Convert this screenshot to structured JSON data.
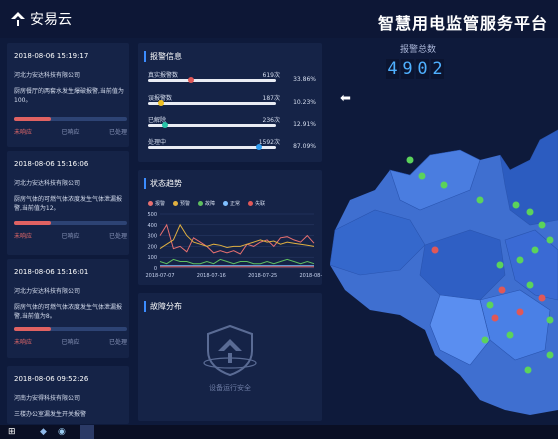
{
  "header": {
    "logo_text": "安易云",
    "title": "智慧用电监管服务平台"
  },
  "alarm_total": {
    "label": "报警总数",
    "digits": [
      "4",
      "9",
      "0",
      "2"
    ]
  },
  "feed": [
    {
      "time": "2018-08-06 15:19:17",
      "company": "河北力安达科技有限公司",
      "desc": "厨房餐厅的两套水发生爆破报警,当前值为100。",
      "progress": 0.33,
      "steps": [
        "未响应",
        "已响应",
        "已处理"
      ]
    },
    {
      "time": "2018-08-06 15:16:06",
      "company": "河北力安达科技有限公司",
      "desc": "厨房气体的可燃气体浓度发生气体泄漏报警,当前值为12。",
      "progress": 0.33,
      "steps": [
        "未响应",
        "已响应",
        "已处理"
      ]
    },
    {
      "time": "2018-08-06 15:16:01",
      "company": "河北力安达科技有限公司",
      "desc": "厨房气体的可燃气体浓度发生气体泄漏报警,当前值为8。",
      "progress": 0.33,
      "steps": [
        "未响应",
        "已响应",
        "已处理"
      ]
    },
    {
      "time": "2018-08-06 09:52:26",
      "company": "河南力安得科技有限公司",
      "desc": "三楼办公室漏发生开关报警"
    }
  ],
  "alarm_info": {
    "title": "报警信息",
    "rows": [
      {
        "label": "真实报警数",
        "count": "619次",
        "pct": "33.86%",
        "value": 0.3386,
        "color": "#e05858"
      },
      {
        "label": "误报警数",
        "count": "187次",
        "pct": "10.23%",
        "value": 0.1023,
        "color": "#f0c020"
      },
      {
        "label": "已解除",
        "count": "236次",
        "pct": "12.91%",
        "value": 0.1291,
        "color": "#27c4a8"
      },
      {
        "label": "处理中",
        "count": "1592次",
        "pct": "87.09%",
        "value": 0.8709,
        "color": "#2f9cf0"
      }
    ]
  },
  "status_trend": {
    "title": "状态趋势",
    "legend": [
      "报警",
      "预警",
      "故障",
      "正常",
      "失联"
    ]
  },
  "chart_data": {
    "type": "line",
    "x": [
      "2018-07-07",
      "2018-07-16",
      "2018-07-25",
      "2018-08-05"
    ],
    "ylim": [
      0,
      500
    ],
    "yticks": [
      "500",
      "400",
      "300",
      "200",
      "100",
      "0"
    ],
    "series": [
      {
        "name": "报警",
        "color": "#e87070",
        "values": [
          300,
          400,
          180,
          200,
          150,
          280,
          240,
          200,
          140,
          160,
          140,
          160,
          130,
          220,
          200,
          240,
          260,
          200,
          280,
          290,
          260,
          240,
          300,
          230
        ]
      },
      {
        "name": "预警",
        "color": "#e0b040",
        "values": [
          180,
          220,
          260,
          400,
          300,
          240,
          220,
          200,
          220,
          210,
          190,
          200,
          200,
          220,
          240,
          260,
          240,
          250,
          220,
          240,
          230,
          220,
          210,
          200
        ]
      },
      {
        "name": "故障",
        "color": "#5fbf5f",
        "values": [
          60,
          40,
          80,
          60,
          60,
          40,
          40,
          60,
          40,
          80,
          60,
          40,
          60,
          60,
          40,
          40,
          60,
          40,
          60,
          80,
          60,
          40,
          60,
          40
        ]
      },
      {
        "name": "正常",
        "color": "#7fbfff",
        "values": [
          20,
          20,
          20,
          20,
          20,
          20,
          20,
          20,
          20,
          20,
          20,
          20,
          20,
          20,
          20,
          20,
          20,
          20,
          20,
          20,
          20,
          20,
          20,
          20
        ]
      },
      {
        "name": "失联",
        "color": "#e05858",
        "values": [
          10,
          10,
          10,
          10,
          10,
          10,
          10,
          10,
          10,
          10,
          10,
          10,
          10,
          10,
          10,
          10,
          10,
          10,
          10,
          10,
          10,
          10,
          10,
          10
        ]
      }
    ]
  },
  "fault_dist": {
    "title": "故障分布",
    "empty_text": "设备运行安全"
  }
}
